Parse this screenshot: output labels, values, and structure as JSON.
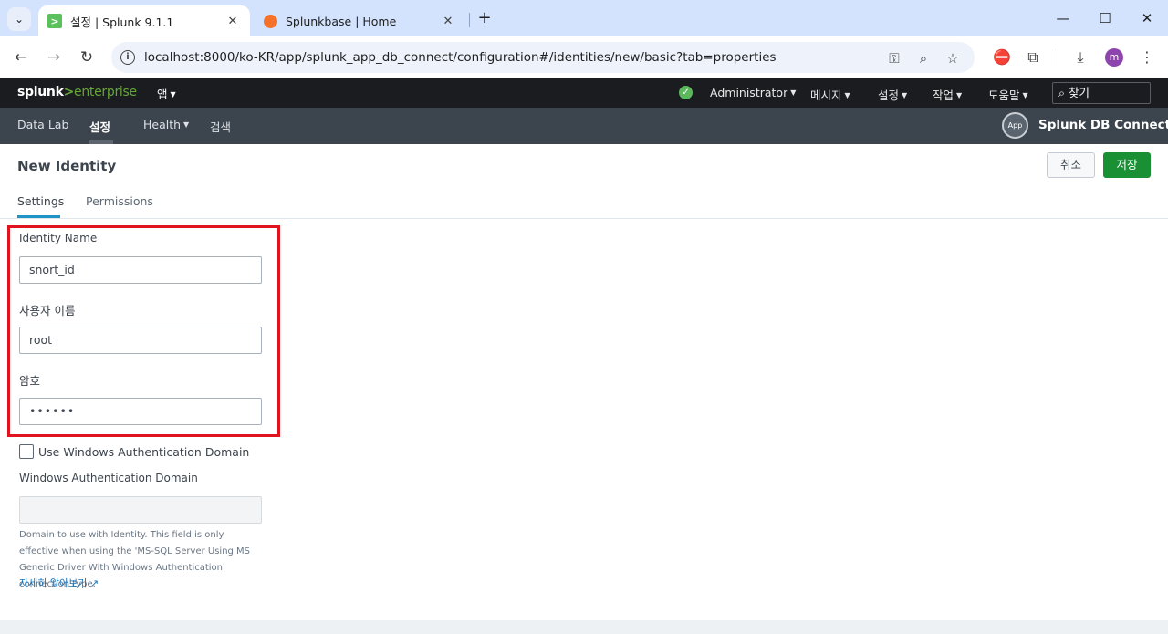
{
  "browser": {
    "tabs": [
      {
        "title": "설정 | Splunk 9.1.1",
        "active": true
      },
      {
        "title": "Splunkbase | Home",
        "active": false
      }
    ],
    "url": "localhost:8000/ko-KR/app/splunk_app_db_connect/configuration#/identities/new/basic?tab=properties",
    "profile_initial": "m"
  },
  "splunk": {
    "logo_splunk": "splunk",
    "logo_gt": ">",
    "logo_enterprise": "enterprise",
    "apps_menu": "앱",
    "top_menu": {
      "user": "Administrator",
      "messages": "메시지",
      "settings": "설정",
      "activity": "작업",
      "help": "도움말",
      "search_placeholder": "찾기"
    },
    "app_nav": [
      "Data Lab",
      "설정",
      "Health",
      "검색"
    ],
    "app_icon_label": "App",
    "app_name": "Splunk DB Connect"
  },
  "page": {
    "title": "New Identity",
    "cancel_label": "취소",
    "save_label": "저장",
    "subtabs": [
      "Settings",
      "Permissions"
    ],
    "fields": {
      "identity_name_label": "Identity Name",
      "identity_name_value": "snort_id",
      "username_label": "사용자 이름",
      "username_value": "root",
      "password_label": "암호",
      "password_value": "••••••",
      "windows_auth_checkbox_label": "Use Windows Authentication Domain",
      "windows_auth_checked": false,
      "windows_domain_label": "Windows Authentication Domain",
      "windows_domain_value": "",
      "help_text": "Domain to use with Identity. This field is only effective when using the 'MS-SQL Server Using MS Generic Driver With Windows Authentication' connection type.",
      "learn_more": "자세히 알아보기"
    }
  },
  "colors": {
    "save_green": "#1a9035",
    "highlight_red": "#e0141e",
    "topbar": "#1a1c20",
    "appbar": "#3c444d",
    "accent_blue": "#1e93c6"
  }
}
